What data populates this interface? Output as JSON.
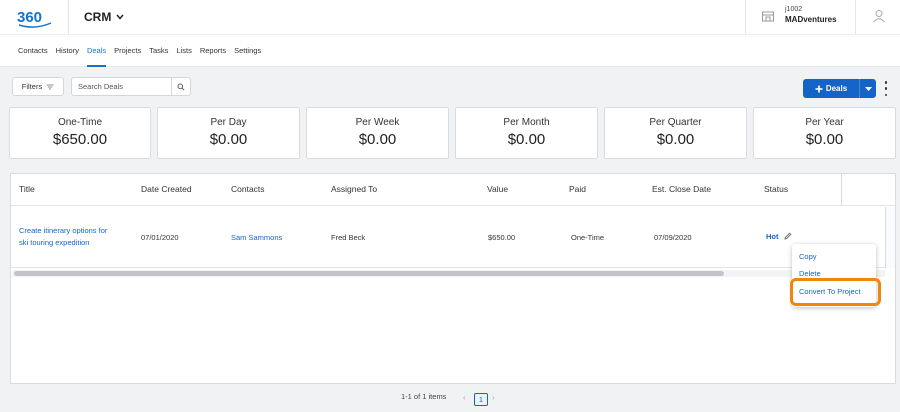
{
  "header": {
    "logo_text": "360",
    "app_name": "CRM",
    "account_id": "j1002",
    "account_name": "MADventures"
  },
  "nav": {
    "items": [
      {
        "label": "Contacts"
      },
      {
        "label": "History"
      },
      {
        "label": "Deals",
        "active": true
      },
      {
        "label": "Projects"
      },
      {
        "label": "Tasks"
      },
      {
        "label": "Lists"
      },
      {
        "label": "Reports"
      },
      {
        "label": "Settings"
      }
    ]
  },
  "toolbar": {
    "filters_label": "Filters",
    "search_placeholder": "Search Deals",
    "add_deals_label": "Deals"
  },
  "summary": [
    {
      "label": "One-Time",
      "value": "$650.00"
    },
    {
      "label": "Per Day",
      "value": "$0.00"
    },
    {
      "label": "Per Week",
      "value": "$0.00"
    },
    {
      "label": "Per Month",
      "value": "$0.00"
    },
    {
      "label": "Per Quarter",
      "value": "$0.00"
    },
    {
      "label": "Per Year",
      "value": "$0.00"
    }
  ],
  "table": {
    "columns": [
      "Title",
      "Date Created",
      "Contacts",
      "Assigned To",
      "Value",
      "Paid",
      "Est. Close Date",
      "Status"
    ],
    "rows": [
      {
        "title_line1": "Create itinerary options for",
        "title_line2": "ski touring expedition",
        "date_created": "07/01/2020",
        "contact": "Sam Sammons",
        "assigned_to": "Fred Beck",
        "value": "$650.00",
        "paid": "One-Time",
        "close_date": "07/09/2020",
        "status": "Hot"
      }
    ]
  },
  "row_menu": {
    "items": [
      "Copy",
      "Delete",
      "Convert To Project"
    ],
    "highlight_color": "#f0870c"
  },
  "pagination": {
    "summary": "1-1 of 1 items",
    "current_page": "1"
  },
  "colors": {
    "accent": "#1464c8",
    "highlight": "#f0870c"
  }
}
